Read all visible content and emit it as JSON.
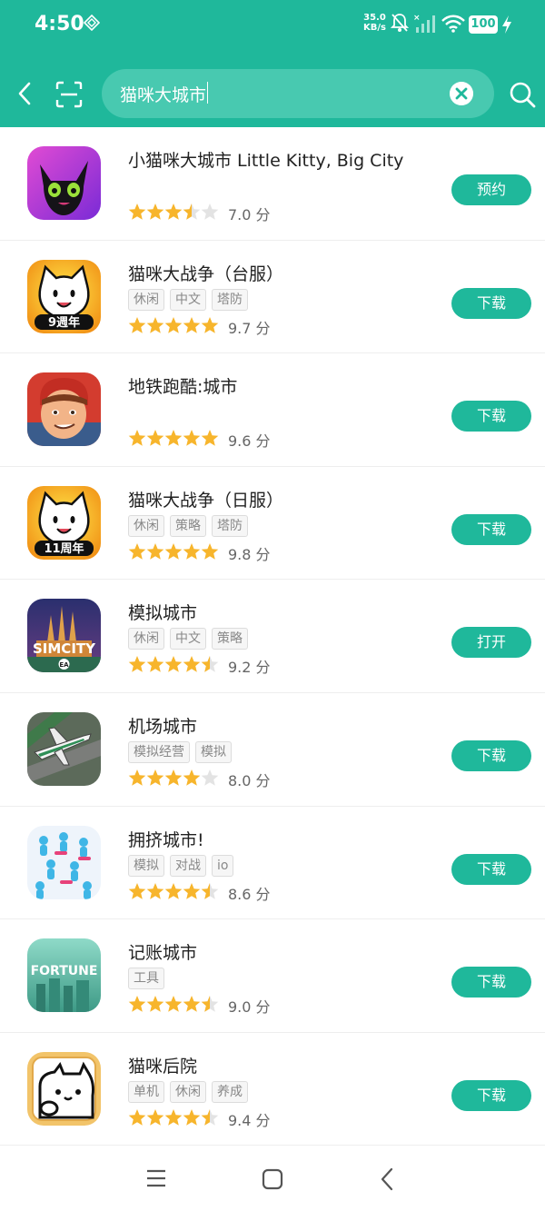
{
  "status_bar": {
    "time": "4:50",
    "net_speed_value": "35.0",
    "net_speed_unit": "KB/s",
    "battery": "100"
  },
  "search": {
    "query": "猫咪大城市"
  },
  "colors": {
    "accent": "#1fb89b",
    "star_on": "#f7b52c",
    "star_off": "#e3e3e3"
  },
  "results": [
    {
      "name": "小猫咪大城市 Little Kitty, Big City",
      "tags": [],
      "rating": 3.5,
      "score": "7.0 分",
      "action": "预约",
      "icon": "black-cat-icon"
    },
    {
      "name": "猫咪大战争（台服）",
      "tags": [
        "休闲",
        "中文",
        "塔防"
      ],
      "rating": 5,
      "score": "9.7 分",
      "action": "下载",
      "icon": "battle-cats-9th-icon",
      "icon_badge": "9週年"
    },
    {
      "name": "地铁跑酷:城市",
      "tags": [],
      "rating": 5,
      "score": "9.6 分",
      "action": "下载",
      "icon": "subway-surfer-icon"
    },
    {
      "name": "猫咪大战争（日服）",
      "tags": [
        "休闲",
        "策略",
        "塔防"
      ],
      "rating": 5,
      "score": "9.8 分",
      "action": "下载",
      "icon": "battle-cats-11th-icon",
      "icon_badge": "11周年"
    },
    {
      "name": "模拟城市",
      "tags": [
        "休闲",
        "中文",
        "策略"
      ],
      "rating": 4.5,
      "score": "9.2 分",
      "action": "打开",
      "icon": "simcity-icon",
      "icon_text": "SIMCITY",
      "icon_sub": "EA"
    },
    {
      "name": "机场城市",
      "tags": [
        "模拟经营",
        "模拟"
      ],
      "rating": 4,
      "score": "8.0 分",
      "action": "下载",
      "icon": "airplane-icon"
    },
    {
      "name": "拥挤城市!",
      "tags": [
        "模拟",
        "对战",
        "io"
      ],
      "rating": 4.5,
      "score": "8.6 分",
      "action": "下载",
      "icon": "crowd-runners-icon"
    },
    {
      "name": "记账城市",
      "tags": [
        "工具"
      ],
      "rating": 4.5,
      "score": "9.0 分",
      "action": "下载",
      "icon": "fortune-city-icon",
      "icon_text": "FORTUNE"
    },
    {
      "name": "猫咪后院",
      "tags": [
        "单机",
        "休闲",
        "养成"
      ],
      "rating": 4.5,
      "score": "9.4 分",
      "action": "下载",
      "icon": "neko-atsume-icon"
    }
  ],
  "nav": {
    "menu_icon": "menu-icon",
    "home_icon": "home-icon",
    "back_icon": "back-icon"
  }
}
